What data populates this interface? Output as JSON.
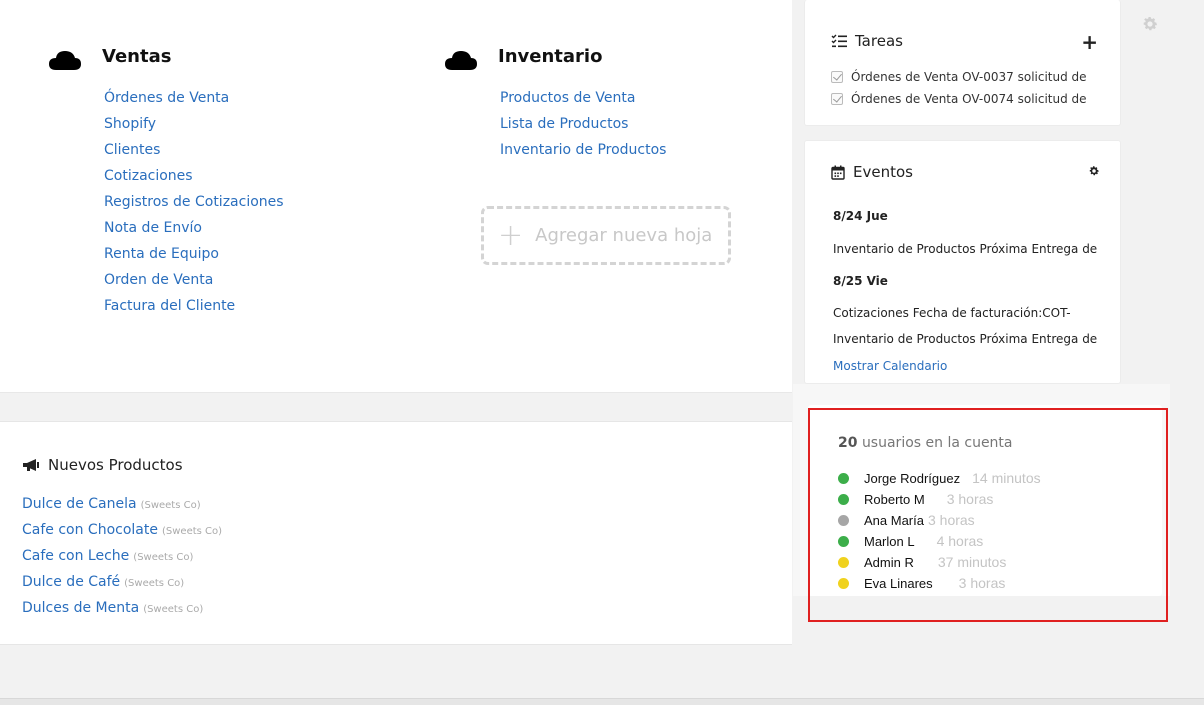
{
  "modules": [
    {
      "title": "Ventas",
      "links": [
        "Órdenes de Venta",
        "Shopify",
        "Clientes",
        "Cotizaciones",
        "Registros de Cotizaciones",
        "Nota de Envío",
        "Renta de Equipo",
        "Orden de Venta",
        "Factura del Cliente"
      ]
    },
    {
      "title": "Inventario",
      "links": [
        "Productos de Venta",
        "Lista de Productos",
        "Inventario de Productos"
      ]
    }
  ],
  "add_sheet": {
    "label": "Agregar nueva hoja",
    "icon": "plus-icon"
  },
  "news": {
    "title": "Nuevos Productos",
    "icon": "megaphone-icon",
    "items": [
      {
        "name": "Dulce de Canela",
        "vendor": "(Sweets Co)"
      },
      {
        "name": "Cafe con Chocolate",
        "vendor": "(Sweets Co)"
      },
      {
        "name": "Cafe con Leche",
        "vendor": "(Sweets Co)"
      },
      {
        "name": "Dulce de Café",
        "vendor": "(Sweets Co)"
      },
      {
        "name": "Dulces de Menta",
        "vendor": "(Sweets Co)"
      }
    ]
  },
  "tasks": {
    "title": "Tareas",
    "icon": "task-list-icon",
    "add_icon": "plus-icon",
    "items": [
      "Órdenes de Venta OV-0037 solicitud de",
      "Órdenes de Venta OV-0074 solicitud de"
    ]
  },
  "events": {
    "title": "Eventos",
    "icon": "calendar-icon",
    "settings_icon": "gear-icon",
    "lines": [
      {
        "kind": "date",
        "text": "8/24 Jue"
      },
      {
        "kind": "item",
        "text": "Inventario de Productos Próxima Entrega de"
      },
      {
        "kind": "date",
        "text": "8/25 Vie"
      },
      {
        "kind": "item",
        "text": "Cotizaciones Fecha de facturación:COT-"
      },
      {
        "kind": "item",
        "text": "Inventario de Productos Próxima Entrega de"
      }
    ],
    "calendar_link": "Mostrar Calendario"
  },
  "users": {
    "count": "20",
    "count_label": "usuarios en la cuenta",
    "list": [
      {
        "name": "Jorge Rodríguez",
        "time": "14 minutos",
        "status_color": "#3cae4a"
      },
      {
        "name": "Roberto M",
        "time": "3 horas",
        "status_color": "#3cae4a"
      },
      {
        "name": "Ana María",
        "time": "3 horas",
        "status_color": "#a6a6a6"
      },
      {
        "name": "Marlon L",
        "time": "4 horas",
        "status_color": "#3cae4a"
      },
      {
        "name": "Admin R",
        "time": "37 minutos",
        "status_color": "#f0d21e"
      },
      {
        "name": "Eva Linares",
        "time": "3 horas",
        "status_color": "#f0d21e"
      }
    ]
  },
  "colors": {
    "link": "#2a6ebd",
    "highlight": "#e02020"
  }
}
